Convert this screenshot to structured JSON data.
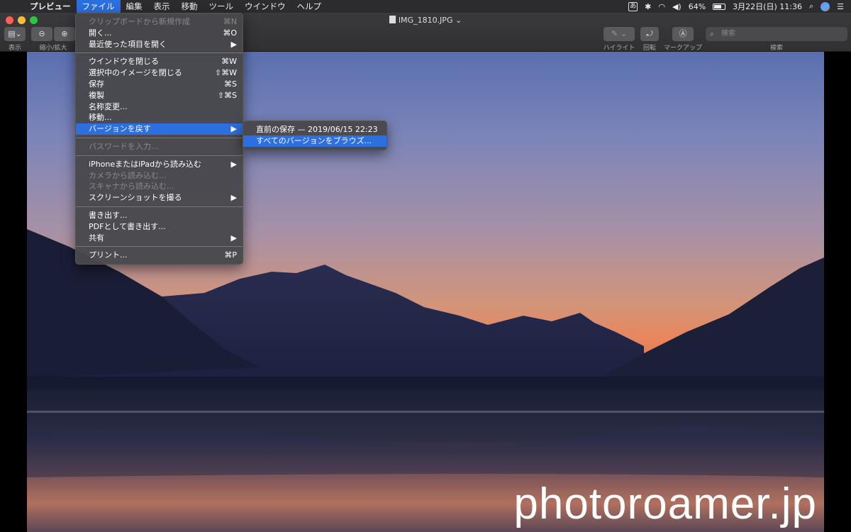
{
  "menubar": {
    "app_name": "プレビュー",
    "items": [
      "ファイル",
      "編集",
      "表示",
      "移動",
      "ツール",
      "ウインドウ",
      "ヘルプ"
    ],
    "status": {
      "input_method": "あ",
      "battery": "64%",
      "datetime": "3月22日(日) 11:36"
    }
  },
  "window": {
    "title": "IMG_1810.JPG ⌄",
    "toolbar": {
      "view_label": "表示",
      "zoom_label": "縮小/拡大",
      "highlight_label": "ハイライト",
      "rotate_label": "回転",
      "markup_label": "マークアップ",
      "search_label": "検索",
      "search_placeholder": "検索"
    }
  },
  "file_menu": {
    "items": [
      {
        "label": "クリップボードから新規作成",
        "shortcut": "⌘N",
        "disabled": true
      },
      {
        "label": "開く...",
        "shortcut": "⌘O"
      },
      {
        "label": "最近使った項目を開く",
        "shortcut": "▶"
      },
      {
        "sep": true
      },
      {
        "label": "ウインドウを閉じる",
        "shortcut": "⌘W"
      },
      {
        "label": "選択中のイメージを閉じる",
        "shortcut": "⇧⌘W"
      },
      {
        "label": "保存",
        "shortcut": "⌘S"
      },
      {
        "label": "複製",
        "shortcut": "⇧⌘S"
      },
      {
        "label": "名称変更...",
        "shortcut": ""
      },
      {
        "label": "移動...",
        "shortcut": ""
      },
      {
        "label": "バージョンを戻す",
        "shortcut": "▶",
        "selected": true
      },
      {
        "sep": true
      },
      {
        "label": "パスワードを入力...",
        "shortcut": "",
        "disabled": true
      },
      {
        "sep": true
      },
      {
        "label": "iPhoneまたはiPadから読み込む",
        "shortcut": "▶"
      },
      {
        "label": "カメラから読み込む...",
        "shortcut": "",
        "disabled": true
      },
      {
        "label": "スキャナから読み込む...",
        "shortcut": "",
        "disabled": true
      },
      {
        "label": "スクリーンショットを撮る",
        "shortcut": "▶"
      },
      {
        "sep": true
      },
      {
        "label": "書き出す...",
        "shortcut": ""
      },
      {
        "label": "PDFとして書き出す...",
        "shortcut": ""
      },
      {
        "label": "共有",
        "shortcut": "▶"
      },
      {
        "sep": true
      },
      {
        "label": "プリント...",
        "shortcut": "⌘P"
      }
    ]
  },
  "submenu": {
    "items": [
      {
        "label": "直前の保存 — 2019/06/15 22:23"
      },
      {
        "label": "すべてのバージョンをブラウズ...",
        "selected": true
      }
    ]
  },
  "photo": {
    "watermark": "photoroamer.jp"
  },
  "colors": {
    "menu_highlight": "#2b6fe0",
    "menubar_bg": "#2c2c2e"
  }
}
